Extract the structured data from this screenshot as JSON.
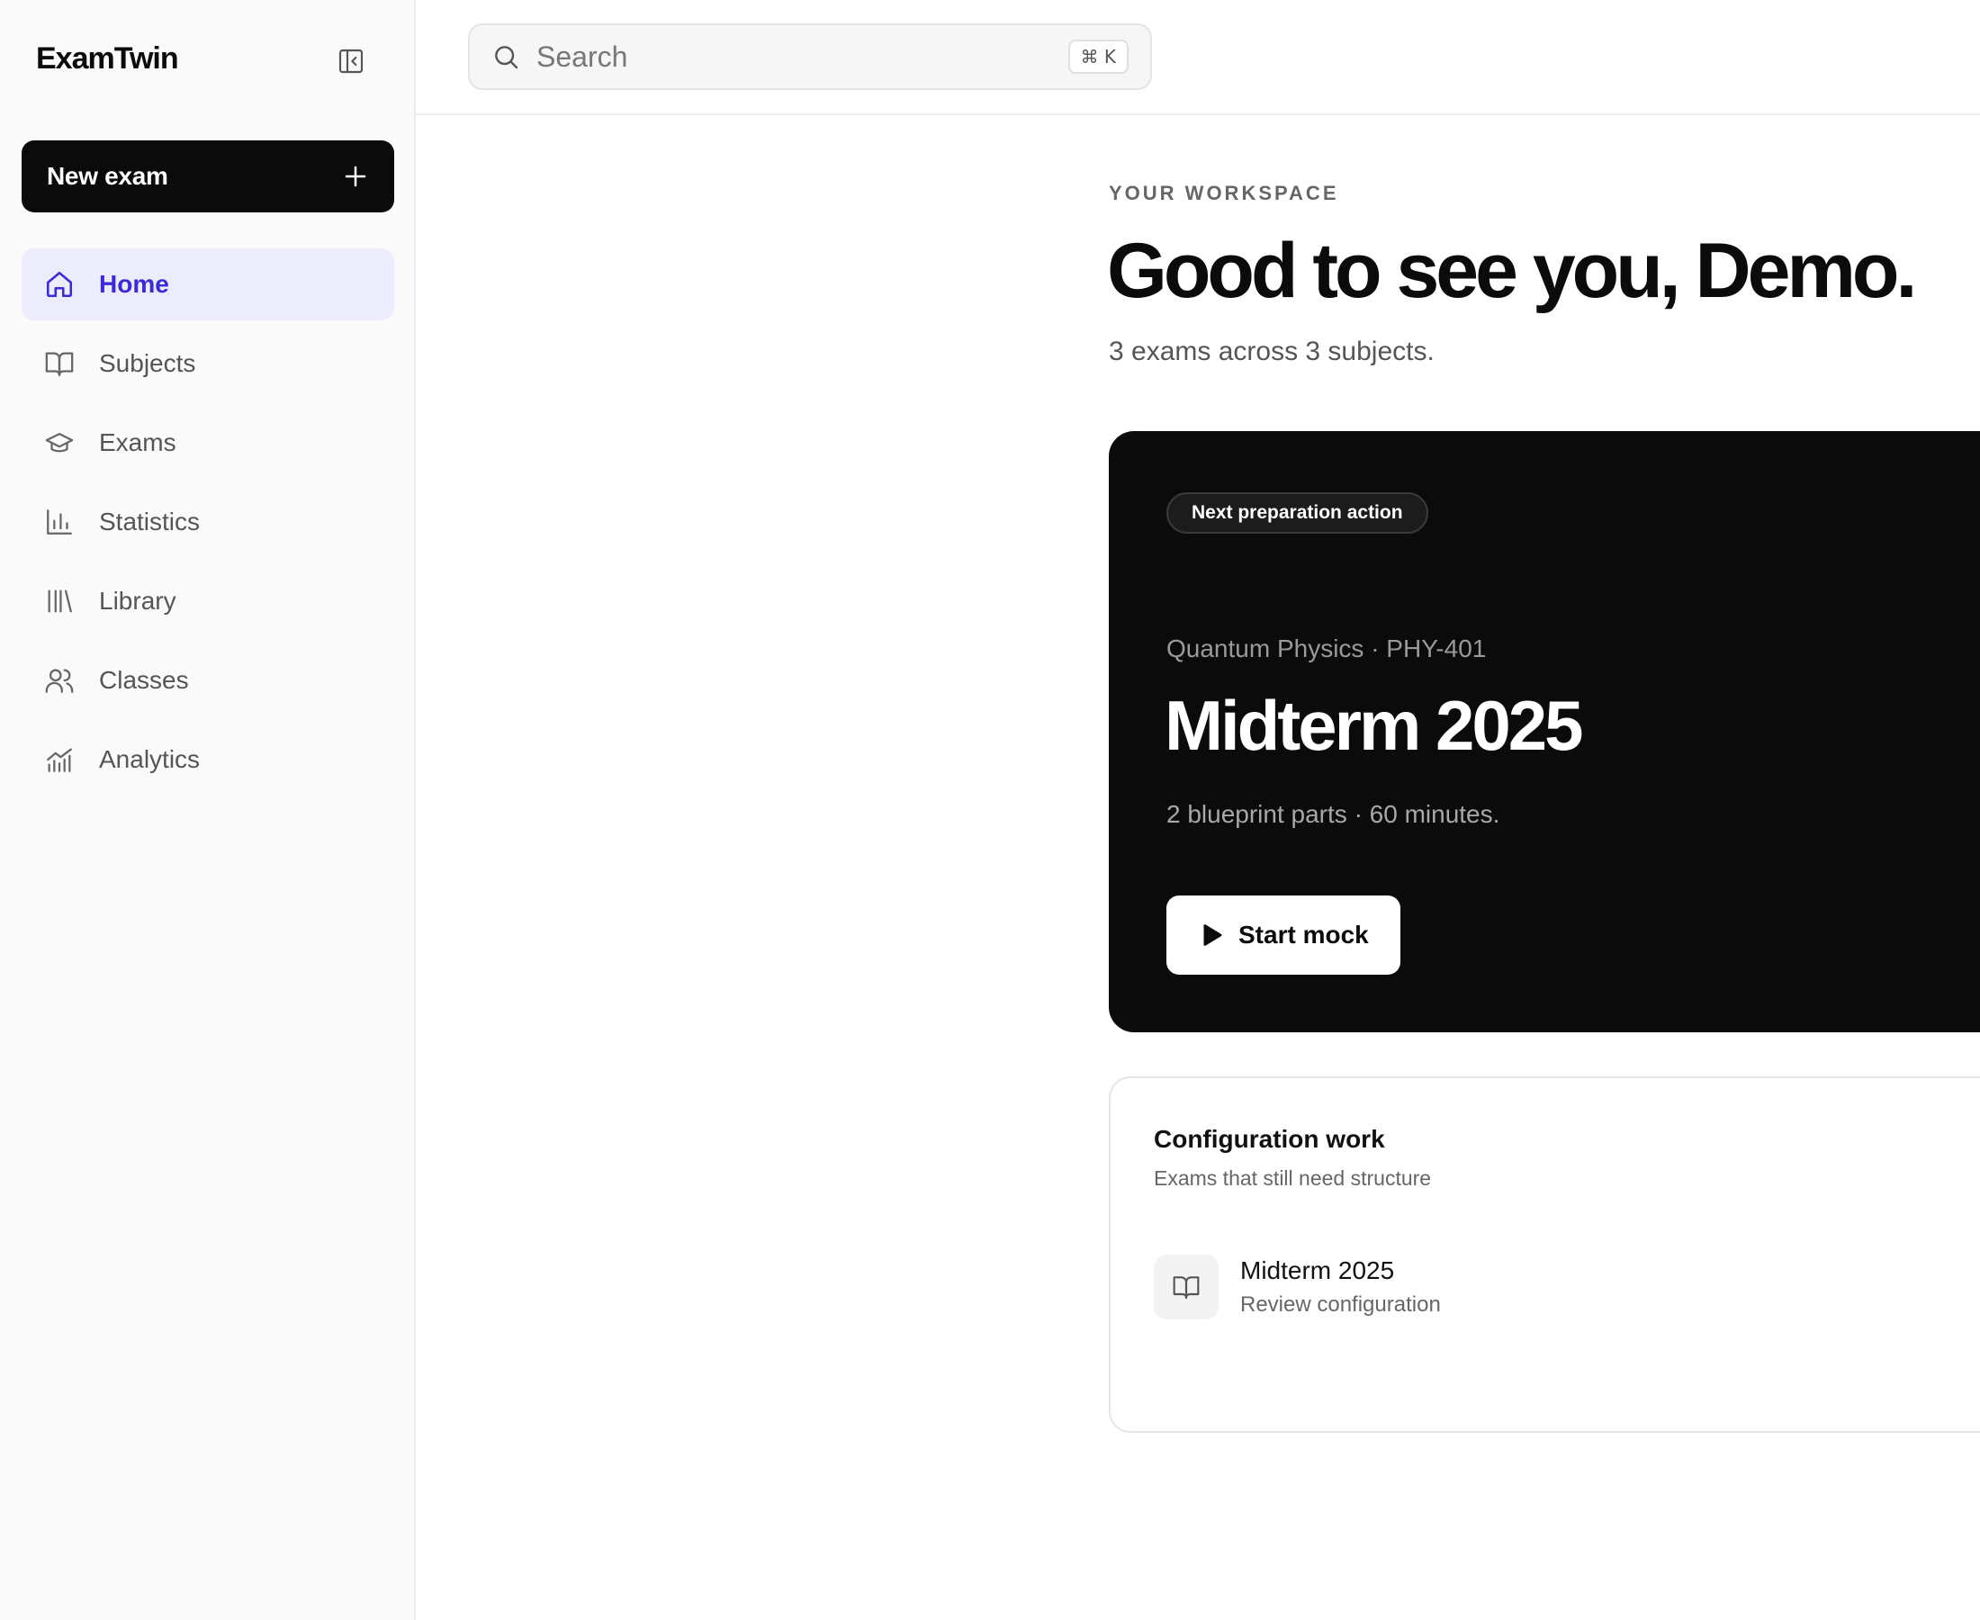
{
  "app": {
    "brand": "ExamTwin"
  },
  "sidebar": {
    "new_exam_label": "New exam",
    "items": [
      {
        "label": "Home",
        "icon": "home-icon",
        "active": true
      },
      {
        "label": "Subjects",
        "icon": "book-icon"
      },
      {
        "label": "Exams",
        "icon": "graduation-cap-icon"
      },
      {
        "label": "Statistics",
        "icon": "bar-chart-icon"
      },
      {
        "label": "Library",
        "icon": "library-icon"
      },
      {
        "label": "Classes",
        "icon": "users-icon"
      },
      {
        "label": "Analytics",
        "icon": "analytics-icon"
      }
    ]
  },
  "search": {
    "placeholder": "Search",
    "shortcut": "⌘ K"
  },
  "main": {
    "eyebrow": "YOUR WORKSPACE",
    "greeting": "Good to see you, Demo.",
    "summary": "3 exams across 3 subjects."
  },
  "hero": {
    "badge": "Next preparation action",
    "course": "Quantum Physics · PHY-401",
    "title": "Midterm 2025",
    "meta": "2 blueprint parts · 60 minutes.",
    "cta": "Start mock"
  },
  "config": {
    "title": "Configuration work",
    "subtitle": "Exams that still need structure",
    "items": [
      {
        "title": "Midterm 2025",
        "subtitle": "Review configuration",
        "icon": "book-icon"
      }
    ]
  },
  "colors": {
    "accent": "#3a2bd6",
    "active_bg": "#ececfd",
    "hero_bg": "#0b0b0b"
  }
}
